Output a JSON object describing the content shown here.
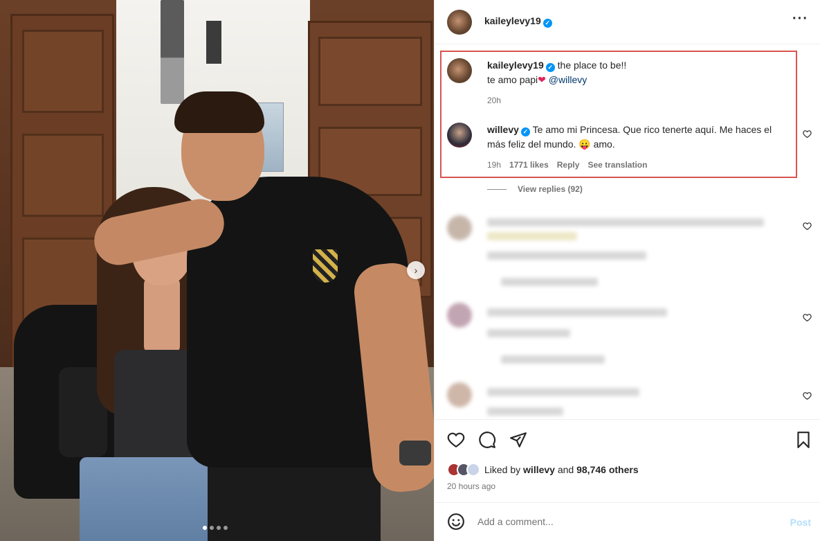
{
  "post": {
    "author": "kaileylevy19",
    "more_icon": "more-icon",
    "pagination": {
      "total": 4,
      "active": 0
    }
  },
  "caption": {
    "username": "kaileylevy19",
    "line1": "the place to be!!",
    "line2": "te amo papi",
    "heart_emoji": "❤",
    "mention": "@willevy",
    "time": "20h"
  },
  "reply": {
    "username": "willevy",
    "text": "Te amo mi Princesa. Que rico tenerte aquí. Me haces el más feliz del mundo. 😛 amo.",
    "time": "19h",
    "likes": "1771 likes",
    "reply_label": "Reply",
    "translate_label": "See translation",
    "view_replies": "View replies (92)"
  },
  "actions": {
    "liked_by_prefix": "Liked by",
    "liked_by_user": "willevy",
    "liked_and": "and",
    "liked_others": "98,746 others",
    "time_ago": "20 hours ago"
  },
  "composer": {
    "placeholder": "Add a comment...",
    "post_label": "Post"
  },
  "colors": {
    "highlight_border": "#d9534f",
    "verified": "#0095f6",
    "post_button": "#b2dffc"
  }
}
